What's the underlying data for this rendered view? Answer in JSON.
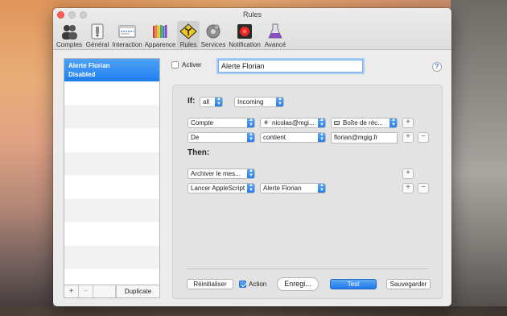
{
  "window": {
    "title": "Rules"
  },
  "toolbar": {
    "items": [
      {
        "label": "Comptes",
        "icon": "people-icon"
      },
      {
        "label": "Général",
        "icon": "switch-icon"
      },
      {
        "label": "Interaction",
        "icon": "window-icon"
      },
      {
        "label": "Apparence",
        "icon": "pencils-icon"
      },
      {
        "label": "Rules",
        "icon": "road-sign-icon",
        "selected": true
      },
      {
        "label": "Services",
        "icon": "gears-icon"
      },
      {
        "label": "Notification",
        "icon": "record-icon"
      },
      {
        "label": "Avancé",
        "icon": "flask-icon"
      }
    ]
  },
  "sidebar": {
    "rules": [
      {
        "name": "Alerte Florian",
        "status": "Disabled",
        "selected": true
      }
    ],
    "add_label": "+",
    "remove_label": "−",
    "duplicate_label": "Duplicate"
  },
  "header": {
    "activate_label": "Activer",
    "activate_checked": false,
    "rule_name": "Alerte Florian",
    "help_label": "?"
  },
  "conditions": {
    "if_label": "If:",
    "match": "all",
    "direction": "Incoming",
    "rows": [
      {
        "field": "Compte",
        "operator": "nicolas@mgi...",
        "value": "Boîte de réc..."
      },
      {
        "field": "De",
        "operator": "contient",
        "value": "florian@mgig.fr"
      }
    ]
  },
  "actions": {
    "then_label": "Then:",
    "rows": [
      {
        "action": "Archiver le mes..."
      },
      {
        "action": "Lancer AppleScript",
        "target": "Alerte Florian"
      }
    ]
  },
  "footer": {
    "reset_label": "Réinitialiser",
    "action_label": "Action",
    "action_checked": true,
    "record_label": "Enregi...",
    "test_label": "Test",
    "save_label": "Sauvegarder"
  },
  "colors": {
    "accent": "#1f7ef0",
    "close": "#ff5f57"
  }
}
